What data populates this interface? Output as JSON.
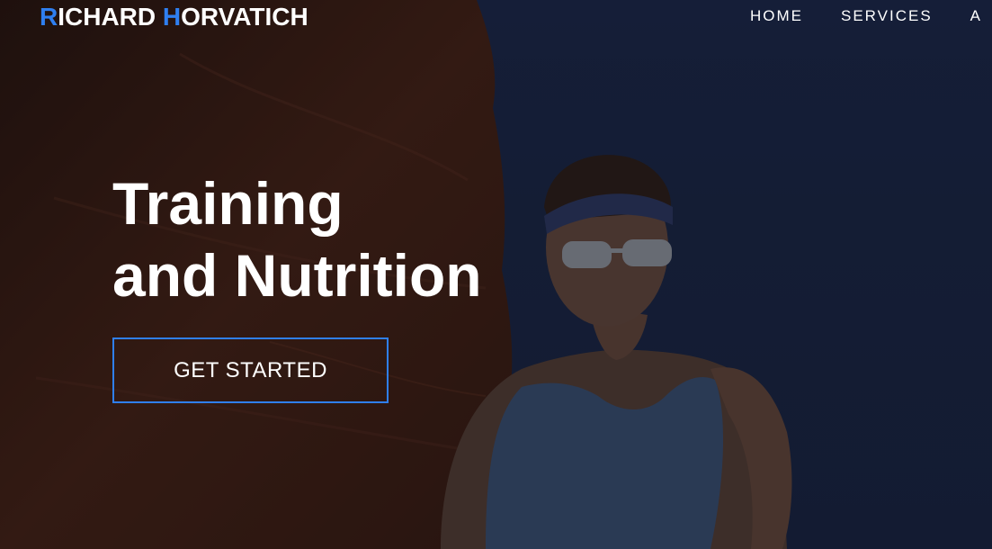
{
  "header": {
    "logo": {
      "first_initial": "R",
      "first_rest": "ICHARD ",
      "last_initial": "H",
      "last_rest": "ORVATICH"
    },
    "nav": {
      "items": [
        {
          "label": "HOME"
        },
        {
          "label": "SERVICES"
        },
        {
          "label": "A"
        }
      ]
    }
  },
  "hero": {
    "title_line_1": "Training",
    "title_line_2": "and Nutrition",
    "cta_label": "GET STARTED"
  },
  "colors": {
    "accent": "#2f7ff0",
    "text": "#ffffff",
    "sky": "#1c2a4d",
    "rock": "#5a2e1a"
  }
}
